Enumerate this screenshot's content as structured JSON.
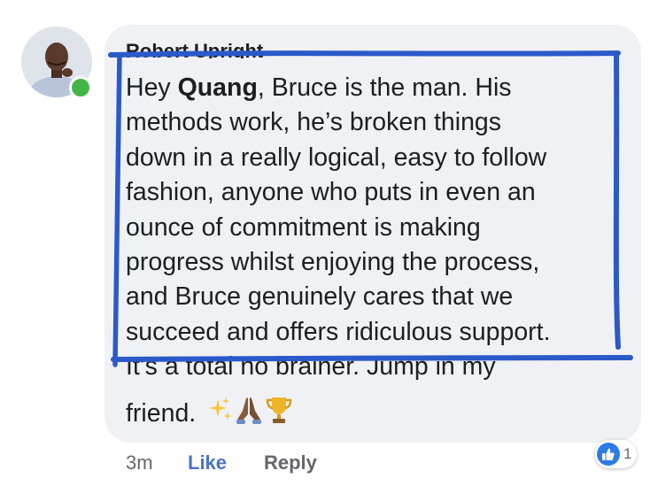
{
  "comment": {
    "author": "Robert Upright",
    "greeting": "Hey ",
    "mention": "Quang",
    "lines": [
      ", Bruce is the man. His",
      "methods work, he’s broken things",
      "down in a really logical, easy to follow",
      "fashion, anyone who puts in even an",
      "ounce  of commitment is making",
      "progress whilst enjoying the process,",
      "and Bruce genuinely cares that we",
      "succeed and offers ridiculous support.",
      "It’s a total no brainer. Jump in my"
    ],
    "final_line": "friend.",
    "emoji_icons": [
      "sparkles-icon",
      "folded-hands-icon",
      "trophy-icon"
    ]
  },
  "actions": {
    "time": "3m",
    "like_label": "Like",
    "reply_label": "Reply"
  },
  "reaction": {
    "icon": "thumbs-up-icon",
    "count": "1"
  },
  "colors": {
    "bubble": "#f0f1f4",
    "like": "#4a74c9",
    "annotation": "#2a59c9",
    "online": "#44b649"
  }
}
